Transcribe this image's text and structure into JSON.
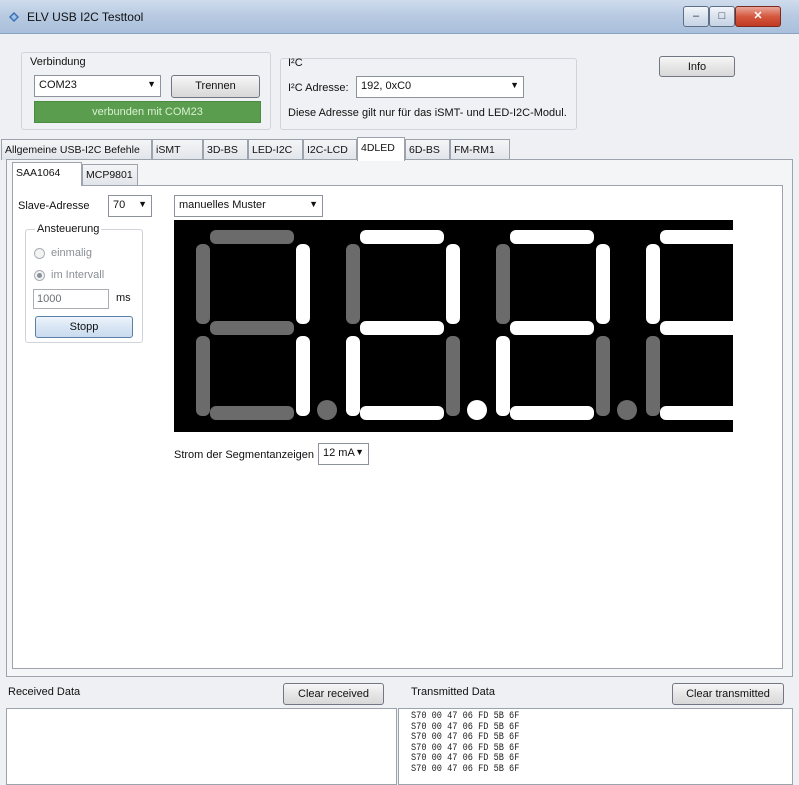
{
  "window": {
    "title": "ELV USB I2C Testtool",
    "minimize": "–",
    "maximize": "□",
    "close": "✕"
  },
  "connection": {
    "group_title": "Verbindung",
    "port": "COM23",
    "disconnect_label": "Trennen",
    "status": "verbunden mit COM23"
  },
  "i2c": {
    "group_title": "I²C",
    "address_label": "I²C Adresse:",
    "address_value": "192, 0xC0",
    "note": "Diese Adresse gilt nur für das iSMT- und LED-I2C-Modul."
  },
  "info_button": "Info",
  "tabs": [
    "Allgemeine USB-I2C Befehle",
    "iSMT",
    "3D-BS",
    "LED-I2C",
    "I2C-LCD",
    "4DLED",
    "6D-BS",
    "FM-RM1"
  ],
  "active_tab": "4DLED",
  "subtabs": [
    "SAA1064",
    "MCP9801"
  ],
  "active_subtab": "SAA1064",
  "led": {
    "slave_label": "Slave-Adresse",
    "slave_value": "70",
    "pattern_value": "manuelles Muster",
    "control_group_title": "Ansteuerung",
    "option_once": "einmalig",
    "option_interval": "im Intervall",
    "interval_value": "1000",
    "interval_unit": "ms",
    "stop_button": "Stopp",
    "current_label": "Strom der Segmentanzeigen",
    "current_value": "12 mA",
    "colors": {
      "on": "#ffffff",
      "off": "#6b6b6b",
      "background": "#000000"
    }
  },
  "received": {
    "label": "Received Data",
    "clear_label": "Clear received"
  },
  "transmitted": {
    "label": "Transmitted Data",
    "clear_label": "Clear transmitted",
    "lines": [
      "S70 00 47 06 FD 5B 6F",
      "S70 00 47 06 FD 5B 6F",
      "S70 00 47 06 FD 5B 6F",
      "S70 00 47 06 FD 5B 6F",
      "S70 00 47 06 FD 5B 6F",
      "S70 00 47 06 FD 5B 6F"
    ]
  }
}
